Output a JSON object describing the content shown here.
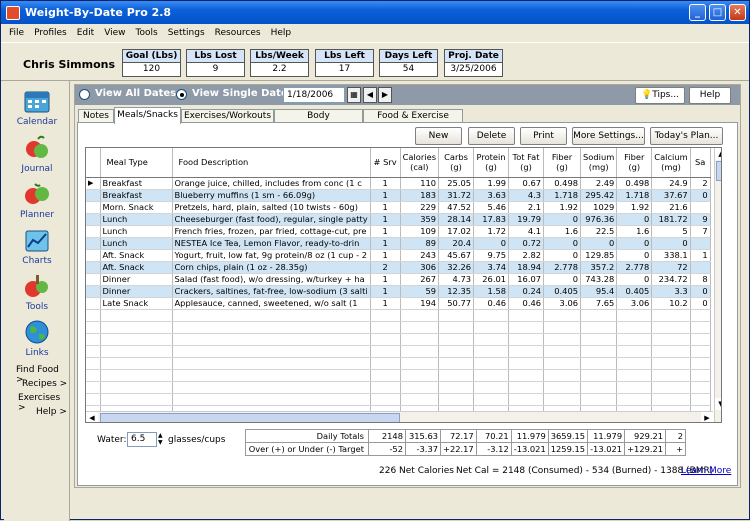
{
  "window": {
    "title": "Weight-By-Date Pro 2.8",
    "min": "_",
    "max": "□",
    "close": "✕"
  },
  "menu": [
    "File",
    "Profiles",
    "Edit",
    "View",
    "Tools",
    "Settings",
    "Resources",
    "Help"
  ],
  "user": "Chris Simmons",
  "stats": [
    {
      "label": "Goal (Lbs)",
      "value": "120"
    },
    {
      "label": "Lbs Lost",
      "value": "9"
    },
    {
      "label": "Lbs/Week",
      "value": "2.2"
    },
    {
      "label": "Lbs Left",
      "value": "17"
    },
    {
      "label": "Days Left",
      "value": "54"
    },
    {
      "label": "Proj. Date",
      "value": "3/25/2006"
    }
  ],
  "nav": [
    "Calendar",
    "Journal",
    "Planner",
    "Charts",
    "Tools",
    "Links"
  ],
  "links": [
    "Find Food  >",
    "Recipes  >",
    "Exercises  >",
    "Help  >"
  ],
  "datebar": {
    "view_all": "View All Dates",
    "view_single": "View Single Date:",
    "date": "1/18/2006",
    "tips": "Tips...",
    "help": "Help"
  },
  "tabs": [
    "Notes",
    "Meals/Snacks",
    "Exercises/Workouts",
    "Body Measurements",
    "Food & Exercise Setup"
  ],
  "actions": [
    "New",
    "Delete",
    "Print",
    "More Settings...",
    "Today's Plan..."
  ],
  "columns": {
    "meal": "Meal Type",
    "food": "Food Description",
    "srv": "# Srv",
    "nums": [
      [
        "Calories",
        "(cal)"
      ],
      [
        "Carbs",
        "(g)"
      ],
      [
        "Protein",
        "(g)"
      ],
      [
        "Tot Fat",
        "(g)"
      ],
      [
        "Fiber",
        "(g)"
      ],
      [
        "Sodium",
        "(mg)"
      ],
      [
        "Fiber",
        "(g)"
      ],
      [
        "Calcium",
        "(mg)"
      ],
      [
        "Sa",
        ""
      ]
    ]
  },
  "rows": [
    {
      "meal": "Breakfast",
      "food": "Orange juice, chilled, includes from conc (1 c",
      "srv": "1",
      "v": [
        "110",
        "25.05",
        "1.99",
        "0.67",
        "0.498",
        "2.49",
        "0.498",
        "24.9",
        "2"
      ]
    },
    {
      "meal": "Breakfast",
      "food": "Blueberry muffins (1 sm - 66.09g)",
      "srv": "1",
      "v": [
        "183",
        "31.72",
        "3.63",
        "4.3",
        "1.718",
        "295.42",
        "1.718",
        "37.67",
        "0"
      ]
    },
    {
      "meal": "Morn. Snack",
      "food": "Pretzels, hard, plain, salted (10 twists - 60g)",
      "srv": "1",
      "v": [
        "229",
        "47.52",
        "5.46",
        "2.1",
        "1.92",
        "1029",
        "1.92",
        "21.6",
        ""
      ]
    },
    {
      "meal": "Lunch",
      "food": "Cheeseburger (fast food), regular, single patty",
      "srv": "1",
      "v": [
        "359",
        "28.14",
        "17.83",
        "19.79",
        "0",
        "976.36",
        "0",
        "181.72",
        "9"
      ]
    },
    {
      "meal": "Lunch",
      "food": "French fries, frozen, par fried, cottage-cut, pre",
      "srv": "1",
      "v": [
        "109",
        "17.02",
        "1.72",
        "4.1",
        "1.6",
        "22.5",
        "1.6",
        "5",
        "7"
      ]
    },
    {
      "meal": "Lunch",
      "food": "NESTEA Ice Tea, Lemon Flavor, ready-to-drin",
      "srv": "1",
      "v": [
        "89",
        "20.4",
        "0",
        "0.72",
        "0",
        "0",
        "0",
        "0",
        ""
      ]
    },
    {
      "meal": "Aft. Snack",
      "food": "Yogurt, fruit, low fat, 9g protein/8 oz (1 cup - 2",
      "srv": "1",
      "v": [
        "243",
        "45.67",
        "9.75",
        "2.82",
        "0",
        "129.85",
        "0",
        "338.1",
        "1"
      ]
    },
    {
      "meal": "Aft. Snack",
      "food": "Corn chips, plain (1 oz - 28.35g)",
      "srv": "2",
      "v": [
        "306",
        "32.26",
        "3.74",
        "18.94",
        "2.778",
        "357.2",
        "2.778",
        "72",
        ""
      ]
    },
    {
      "meal": "Dinner",
      "food": "Salad (fast food), w/o dressing, w/turkey + ha",
      "srv": "1",
      "v": [
        "267",
        "4.73",
        "26.01",
        "16.07",
        "0",
        "743.28",
        "0",
        "234.72",
        "8"
      ]
    },
    {
      "meal": "Dinner",
      "food": "Crackers, saltines, fat-free, low-sodium (3 salti",
      "srv": "1",
      "v": [
        "59",
        "12.35",
        "1.58",
        "0.24",
        "0.405",
        "95.4",
        "0.405",
        "3.3",
        "0"
      ]
    },
    {
      "meal": "Late Snack",
      "food": "Applesauce, canned, sweetened, w/o salt (1",
      "srv": "1",
      "v": [
        "194",
        "50.77",
        "0.46",
        "0.46",
        "3.06",
        "7.65",
        "3.06",
        "10.2",
        "0"
      ]
    }
  ],
  "totals": {
    "label": "Daily Totals",
    "values": [
      "2148",
      "315.63",
      "72.17",
      "70.21",
      "11.979",
      "3659.15",
      "11.979",
      "929.21",
      "2"
    ],
    "target_label": "Over (+) or Under (-) Target",
    "target": [
      "-52",
      "-3.37",
      "+22.17",
      "-3.12",
      "-13.021",
      "1259.15",
      "-13.021",
      "+129.21",
      "+"
    ]
  },
  "water": {
    "label": "Water:",
    "value": "6.5",
    "unit": "glasses/cups"
  },
  "footer": {
    "net": "226 Net Calories",
    "eq": "Net Cal = 2148 (Consumed) - 534 (Burned) - 1388 (BMR)",
    "learn": "Learn More"
  }
}
